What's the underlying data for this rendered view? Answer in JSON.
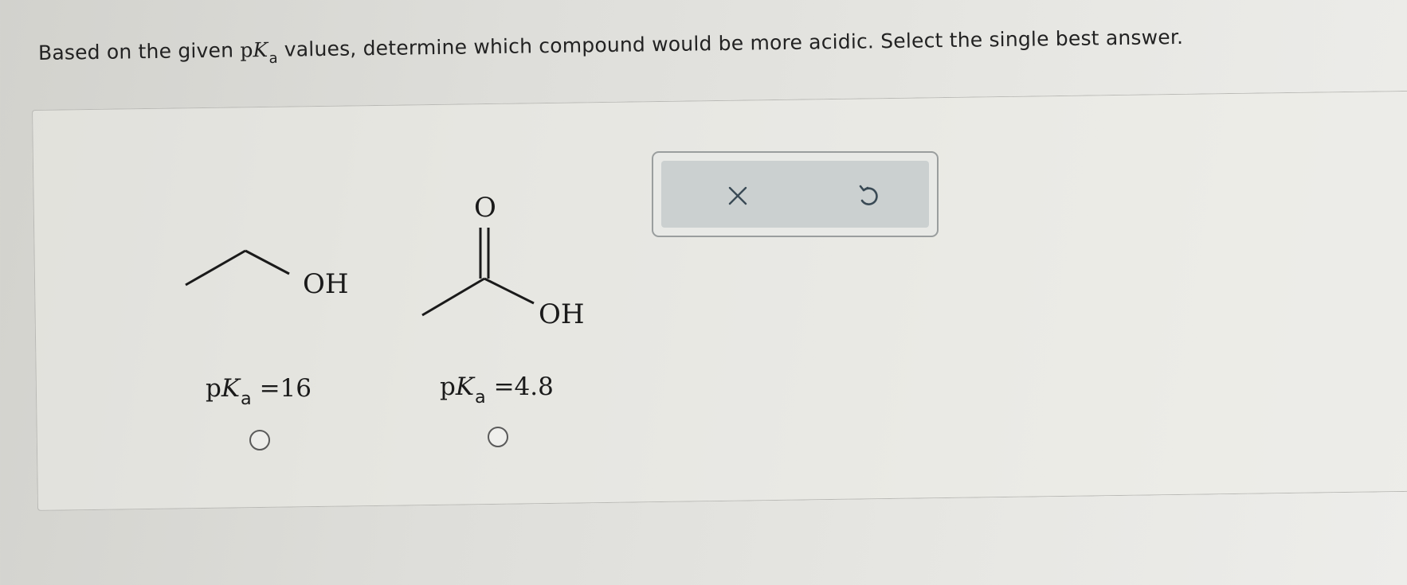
{
  "question": {
    "text_before": "Based on the given ",
    "pka_p": "p",
    "pka_K": "K",
    "pka_a": "a",
    "text_after": " values, determine which compound would be more acidic. Select the single best answer."
  },
  "compounds": [
    {
      "oh_label": "OH",
      "pka": {
        "p": "p",
        "K": "K",
        "sub": "a",
        "equals": " =16"
      }
    },
    {
      "o_label": "O",
      "oh_label": "OH",
      "pka": {
        "p": "p",
        "K": "K",
        "sub": "a",
        "equals": " =4.8"
      }
    }
  ],
  "toolbar": {
    "clear_icon": "x-icon",
    "undo_icon": "undo-icon"
  },
  "colors": {
    "toolbar_bg": "#cbd0d0",
    "toolbar_border": "#9a9e9e",
    "ink": "#1a1a1a"
  }
}
